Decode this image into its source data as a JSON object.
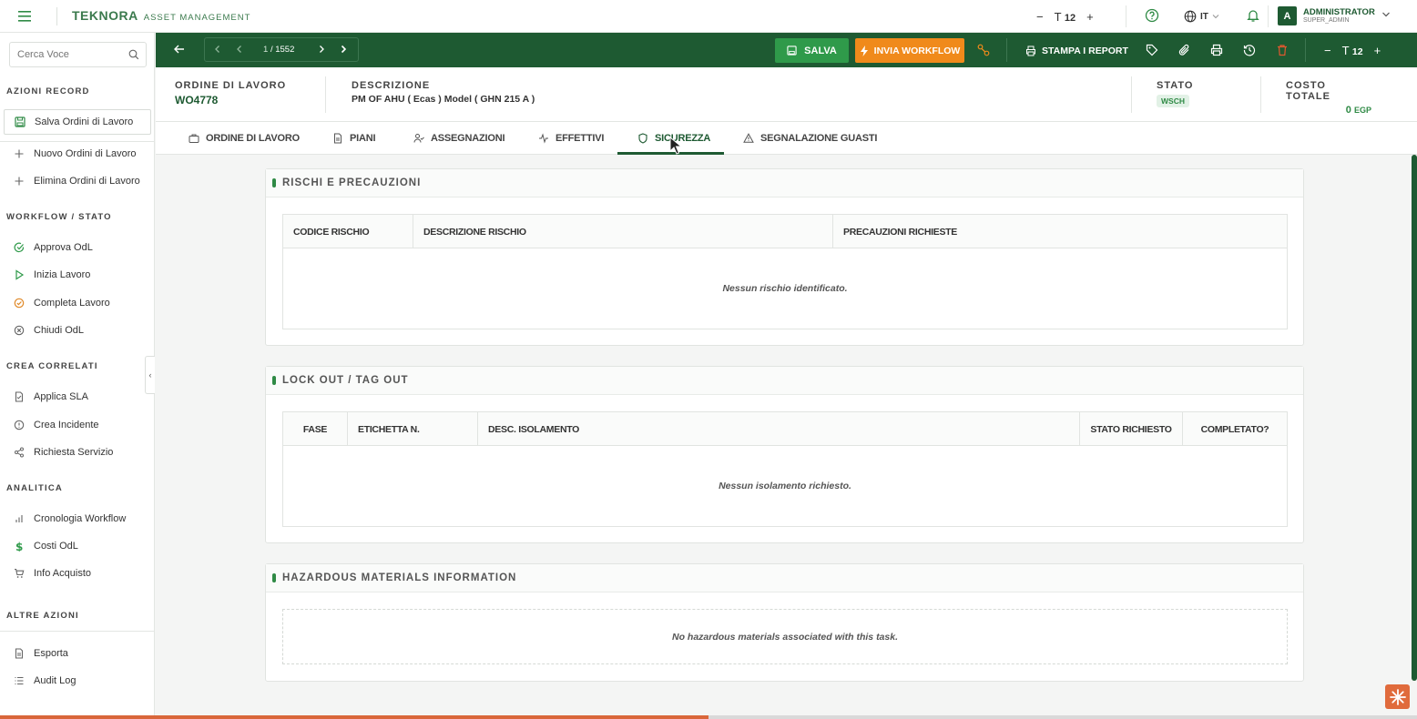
{
  "topbar": {
    "brand_name": "TEKNORA",
    "brand_sub": "ASSET MANAGEMENT",
    "font_size": "12",
    "lang": "IT",
    "user_initial": "A",
    "user_name": "ADMINISTRATOR",
    "user_role": "SUPER_ADMIN"
  },
  "sidebar": {
    "search_placeholder": "Cerca Voce",
    "sections": {
      "azioni_record": "AZIONI RECORD",
      "workflow": "WORKFLOW / STATO",
      "crea_correlati": "CREA CORRELATI",
      "analitica": "ANALITICA",
      "altre_azioni": "ALTRE AZIONI"
    },
    "items": {
      "salva": "Salva Ordini di Lavoro",
      "nuovo": "Nuovo Ordini di Lavoro",
      "elimina": "Elimina Ordini di Lavoro",
      "approva": "Approva OdL",
      "inizia": "Inizia Lavoro",
      "completa": "Completa Lavoro",
      "chiudi": "Chiudi OdL",
      "sla": "Applica SLA",
      "incidente": "Crea Incidente",
      "servizio": "Richiesta Servizio",
      "cronologia": "Cronologia Workflow",
      "costi": "Costi OdL",
      "acquisto": "Info Acquisto",
      "esporta": "Esporta",
      "audit": "Audit Log"
    }
  },
  "toolbar": {
    "page_current": "1",
    "page_total": "/ 1552",
    "save_label": "SALVA",
    "workflow_label": "INVIA WORKFLOW",
    "report_label": "STAMPA I REPORT",
    "font_size": "12"
  },
  "header": {
    "wo_label": "ORDINE DI LAVORO",
    "wo_value": "WO4778",
    "desc_label": "DESCRIZIONE",
    "desc_value": "PM OF AHU ( Ecas ) Model ( GHN 215 A )",
    "stato_label": "STATO",
    "stato_value": "WSCH",
    "costo_label": "COSTO TOTALE",
    "costo_value": "0",
    "costo_unit": "EGP"
  },
  "tabs": {
    "ordine": "ORDINE DI LAVORO",
    "piani": "PIANI",
    "assegnazioni": "ASSEGNAZIONI",
    "effettivi": "EFFETTIVI",
    "sicurezza": "SICUREZZA",
    "guasti": "SEGNALAZIONE GUASTI"
  },
  "panels": {
    "rischi": {
      "title": "RISCHI E PRECAUZIONI",
      "columns": [
        "CODICE RISCHIO",
        "DESCRIZIONE RISCHIO",
        "PRECAUZIONI RICHIESTE"
      ],
      "empty": "Nessun rischio identificato."
    },
    "loto": {
      "title": "LOCK OUT / TAG OUT",
      "columns": [
        "FASE",
        "ETICHETTA N.",
        "DESC. ISOLAMENTO",
        "STATO RICHIESTO",
        "COMPLETATO?"
      ],
      "empty": "Nessun isolamento richiesto."
    },
    "hazmat": {
      "title": "HAZARDOUS MATERIALS INFORMATION",
      "empty": "No hazardous materials associated with this task."
    }
  },
  "progress": {
    "value": 0.5
  },
  "colors": {
    "primary": "#1e5a32",
    "accent": "#f08a1b",
    "success": "#2f9a4a"
  }
}
